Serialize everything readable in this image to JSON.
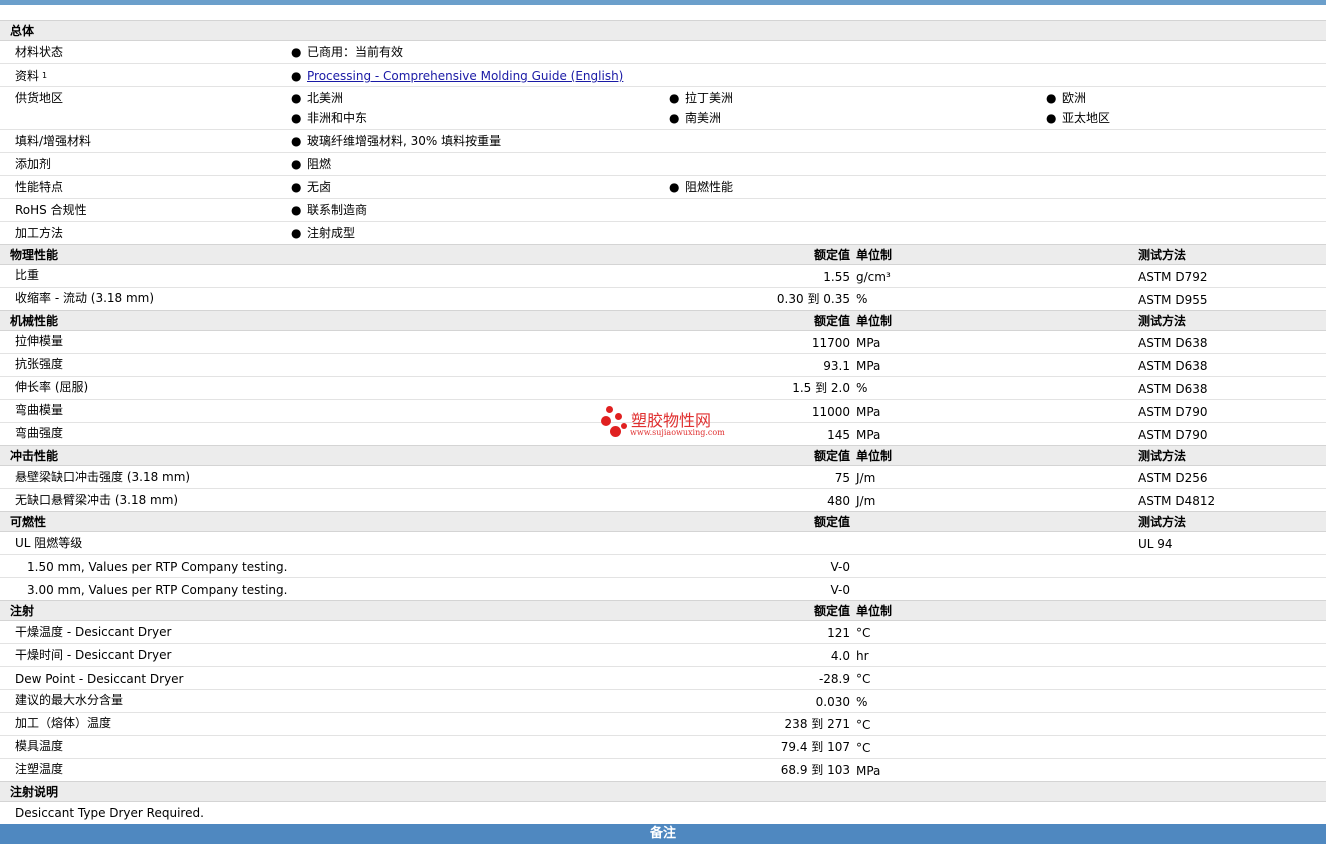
{
  "general": {
    "title": "总体",
    "material_status_label": "材料状态",
    "material_status_value": "已商用：当前有效",
    "literature_label": "资料",
    "literature_sup": "1",
    "literature_link": "Processing - Comprehensive Molding Guide (English)",
    "availability_label": "供货地区",
    "availability": [
      "北美洲",
      "拉丁美洲",
      "欧洲",
      "非洲和中东",
      "南美洲",
      "亚太地区"
    ],
    "filler_label": "填料/增强材料",
    "filler_value": "玻璃纤维增强材料, 30% 填料按重量",
    "additive_label": "添加剂",
    "additive_value": "阻燃",
    "features_label": "性能特点",
    "features": [
      "无卤",
      "阻燃性能"
    ],
    "rohs_label": "RoHS 合规性",
    "rohs_value": "联系制造商",
    "processing_label": "加工方法",
    "processing_value": "注射成型"
  },
  "headers": {
    "nominal": "额定值",
    "unit": "单位制",
    "test": "测试方法"
  },
  "physical": {
    "title": "物理性能",
    "rows": [
      {
        "label": "比重",
        "value": "1.55",
        "unit": "g/cm³",
        "test": "ASTM D792"
      },
      {
        "label": "收缩率  - 流动  (3.18 mm)",
        "value": "0.30 到  0.35",
        "unit": "%",
        "test": "ASTM D955"
      }
    ]
  },
  "mechanical": {
    "title": "机械性能",
    "rows": [
      {
        "label": "拉伸模量",
        "value": "11700",
        "unit": "MPa",
        "test": "ASTM D638"
      },
      {
        "label": "抗张强度",
        "value": "93.1",
        "unit": "MPa",
        "test": "ASTM D638"
      },
      {
        "label": "伸长率  (屈服)",
        "value": "1.5 到  2.0",
        "unit": "%",
        "test": "ASTM D638"
      },
      {
        "label": "弯曲模量",
        "value": "11000",
        "unit": "MPa",
        "test": "ASTM D790"
      },
      {
        "label": "弯曲强度",
        "value": "145",
        "unit": "MPa",
        "test": "ASTM D790"
      }
    ]
  },
  "impact": {
    "title": "冲击性能",
    "rows": [
      {
        "label": "悬壁梁缺口冲击强度  (3.18 mm)",
        "value": "75",
        "unit": "J/m",
        "test": "ASTM D256"
      },
      {
        "label": "无缺口悬臂梁冲击  (3.18 mm)",
        "value": "480",
        "unit": "J/m",
        "test": "ASTM D4812"
      }
    ]
  },
  "flammability": {
    "title": "可燃性",
    "ul_label": "UL 阻燃等级",
    "ul_test": "UL 94",
    "rows": [
      {
        "label": "1.50 mm, Values per RTP Company testing.",
        "value": "V-0"
      },
      {
        "label": "3.00 mm, Values per RTP Company testing.",
        "value": "V-0"
      }
    ]
  },
  "injection": {
    "title": "注射",
    "rows": [
      {
        "label": "干燥温度  - Desiccant Dryer",
        "value": "121",
        "unit": "°C"
      },
      {
        "label": "干燥时间  - Desiccant Dryer",
        "value": "4.0",
        "unit": "hr"
      },
      {
        "label": "Dew Point - Desiccant Dryer",
        "value": "-28.9",
        "unit": "°C"
      },
      {
        "label": "建议的最大水分含量",
        "value": "0.030",
        "unit": "%"
      },
      {
        "label": "加工（熔体）温度",
        "value": "238 到  271",
        "unit": "°C"
      },
      {
        "label": "模具温度",
        "value": "79.4 到  107",
        "unit": "°C"
      },
      {
        "label": "注塑温度",
        "value": "68.9 到  103",
        "unit": "MPa"
      }
    ]
  },
  "injection_notes": {
    "title": "注射说明",
    "text": "Desiccant Type Dryer Required."
  },
  "notes": {
    "title": "备注"
  },
  "watermark": {
    "name": "塑胶物性网",
    "url": "www.sujiaowuxing.com"
  }
}
